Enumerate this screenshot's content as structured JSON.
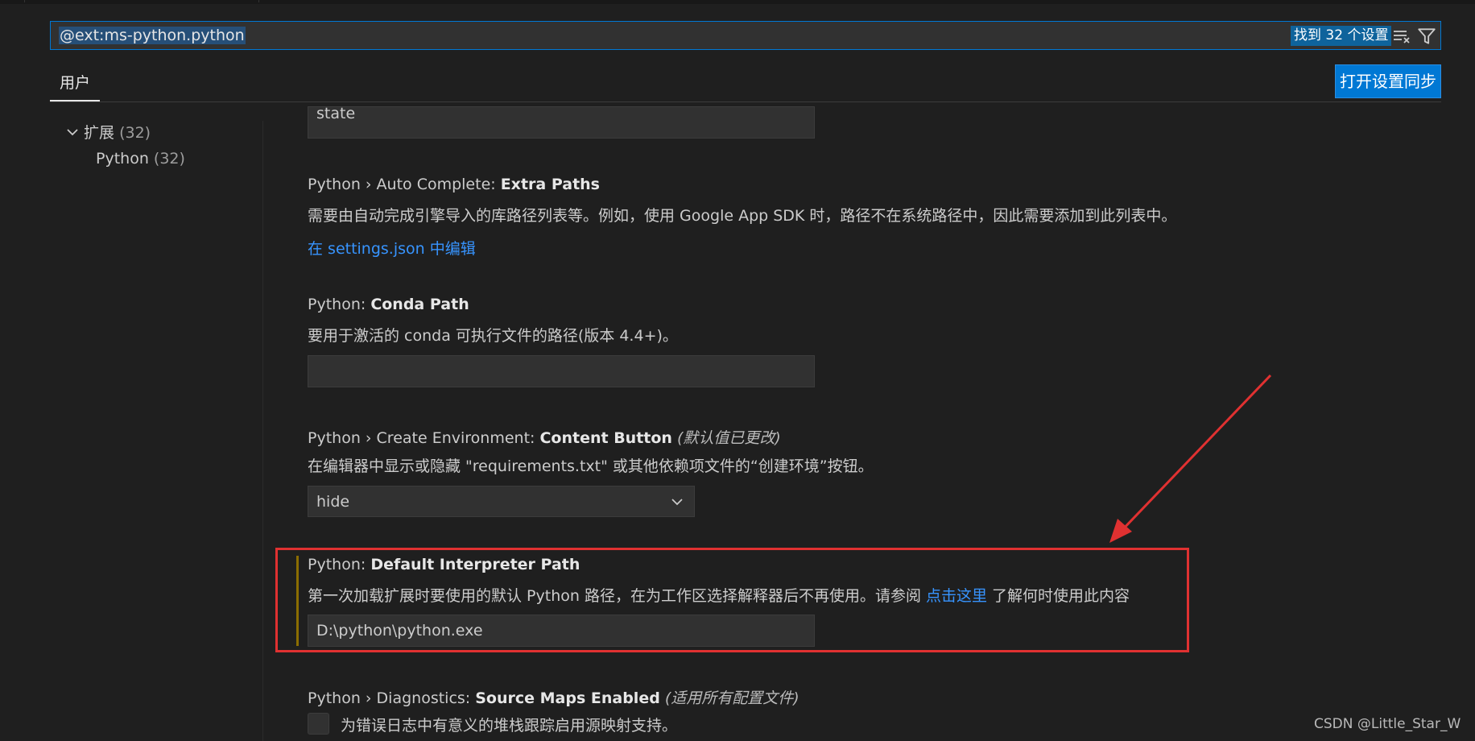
{
  "search": {
    "query": "@ext:ms-python.python",
    "result_count": "找到 32 个设置",
    "clear_icon": "clear-filter-icon",
    "filter_icon": "funnel-icon"
  },
  "tabs": {
    "user_label": "用户",
    "sync_button_label": "打开设置同步"
  },
  "tree": {
    "extensions_label": "扩展",
    "extensions_count": "(32)",
    "python_label": "Python",
    "python_count": "(32)"
  },
  "settings": {
    "prev_input_value": "state",
    "extra_paths": {
      "prefix": "Python › Auto Complete: ",
      "name": "Extra Paths",
      "description": "需要由自动完成引擎导入的库路径列表等。例如，使用 Google App SDK 时，路径不在系统路径中，因此需要添加到此列表中。",
      "link": "在 settings.json 中编辑"
    },
    "conda_path": {
      "prefix": "Python: ",
      "name": "Conda Path",
      "description": "要用于激活的 conda 可执行文件的路径(版本 4.4+)。",
      "value": ""
    },
    "content_button": {
      "prefix": "Python › Create Environment: ",
      "name": "Content Button",
      "modified": "(默认值已更改)",
      "description": "在编辑器中显示或隐藏 \"requirements.txt\" 或其他依赖项文件的“创建环境”按钮。",
      "selected": "hide"
    },
    "default_interpreter": {
      "prefix": "Python: ",
      "name": "Default Interpreter Path",
      "description_before": "第一次加载扩展时要使用的默认 Python 路径，在为工作区选择解释器后不再使用。请参阅 ",
      "link": "点击这里",
      "description_after": " 了解何时使用此内容",
      "value": "D:\\python\\python.exe"
    },
    "source_maps": {
      "prefix": "Python › Diagnostics: ",
      "name": "Source Maps Enabled",
      "scope": "(适用所有配置文件)",
      "description": "为错误日志中有意义的堆栈跟踪启用源映射支持。"
    }
  },
  "annotation_color": "#e03131",
  "accent_color": "#0078d4",
  "watermark": "CSDN @Little_Star_W"
}
